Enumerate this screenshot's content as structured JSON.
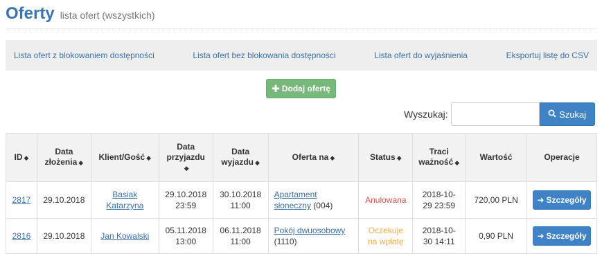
{
  "header": {
    "title": "Oferty",
    "subtitle": "lista ofert (wszystkich)"
  },
  "nav": {
    "blocked": "Lista ofert z blokowaniem dostępności",
    "unblocked": "Lista ofert bez blokowania dostępności",
    "clarify": "Lista ofert do wyjaśnienia",
    "export": "Eksportuj listę do CSV"
  },
  "add_button": "Dodaj ofertę",
  "search": {
    "label": "Wyszukaj:",
    "value": "",
    "button": "Szukaj"
  },
  "table": {
    "headers": {
      "id": "ID",
      "created_1": "Data",
      "created_2": "złożenia",
      "client": "Klient/Gość",
      "arrival_1": "Data",
      "arrival_2": "przyjazdu",
      "departure_1": "Data",
      "departure_2": "wyjazdu",
      "offer": "Oferta na",
      "status": "Status",
      "expires_1": "Traci",
      "expires_2": "ważność",
      "value": "Wartość",
      "ops": "Operacje"
    },
    "rows": [
      {
        "id": "2817",
        "created": "29.10.2018",
        "client_1": "Basiak",
        "client_2": "Katarzyna",
        "arrival_1": "29.10.2018",
        "arrival_2": "23:59",
        "departure_1": "30.10.2018",
        "departure_2": "11:00",
        "offer_1": "Apartament",
        "offer_2": "słoneczny",
        "offer_code": "(004)",
        "status_1": "Anulowana",
        "status_2": "",
        "expires_1": "2018-10-",
        "expires_2": "29 23:59",
        "value": "720,00 PLN",
        "details": "Szczegóły"
      },
      {
        "id": "2816",
        "created": "29.10.2018",
        "client_1": "Jan Kowalski",
        "client_2": "",
        "arrival_1": "05.11.2018",
        "arrival_2": "13:00",
        "departure_1": "06.11.2018",
        "departure_2": "11:00",
        "offer_1": "Pokój dwuosobowy",
        "offer_2": "",
        "offer_code": "(1110)",
        "status_1": "Oczekuje",
        "status_2": "na wpłatę",
        "expires_1": "2018-10-",
        "expires_2": "30 14:11",
        "value": "0,90 PLN",
        "details": "Szczegóły"
      }
    ]
  },
  "colors": {
    "brand": "#3a75b0",
    "add": "#78b97b",
    "primary": "#3f82c5",
    "cancelled": "#d9534f",
    "pending": "#f0ad4e"
  }
}
